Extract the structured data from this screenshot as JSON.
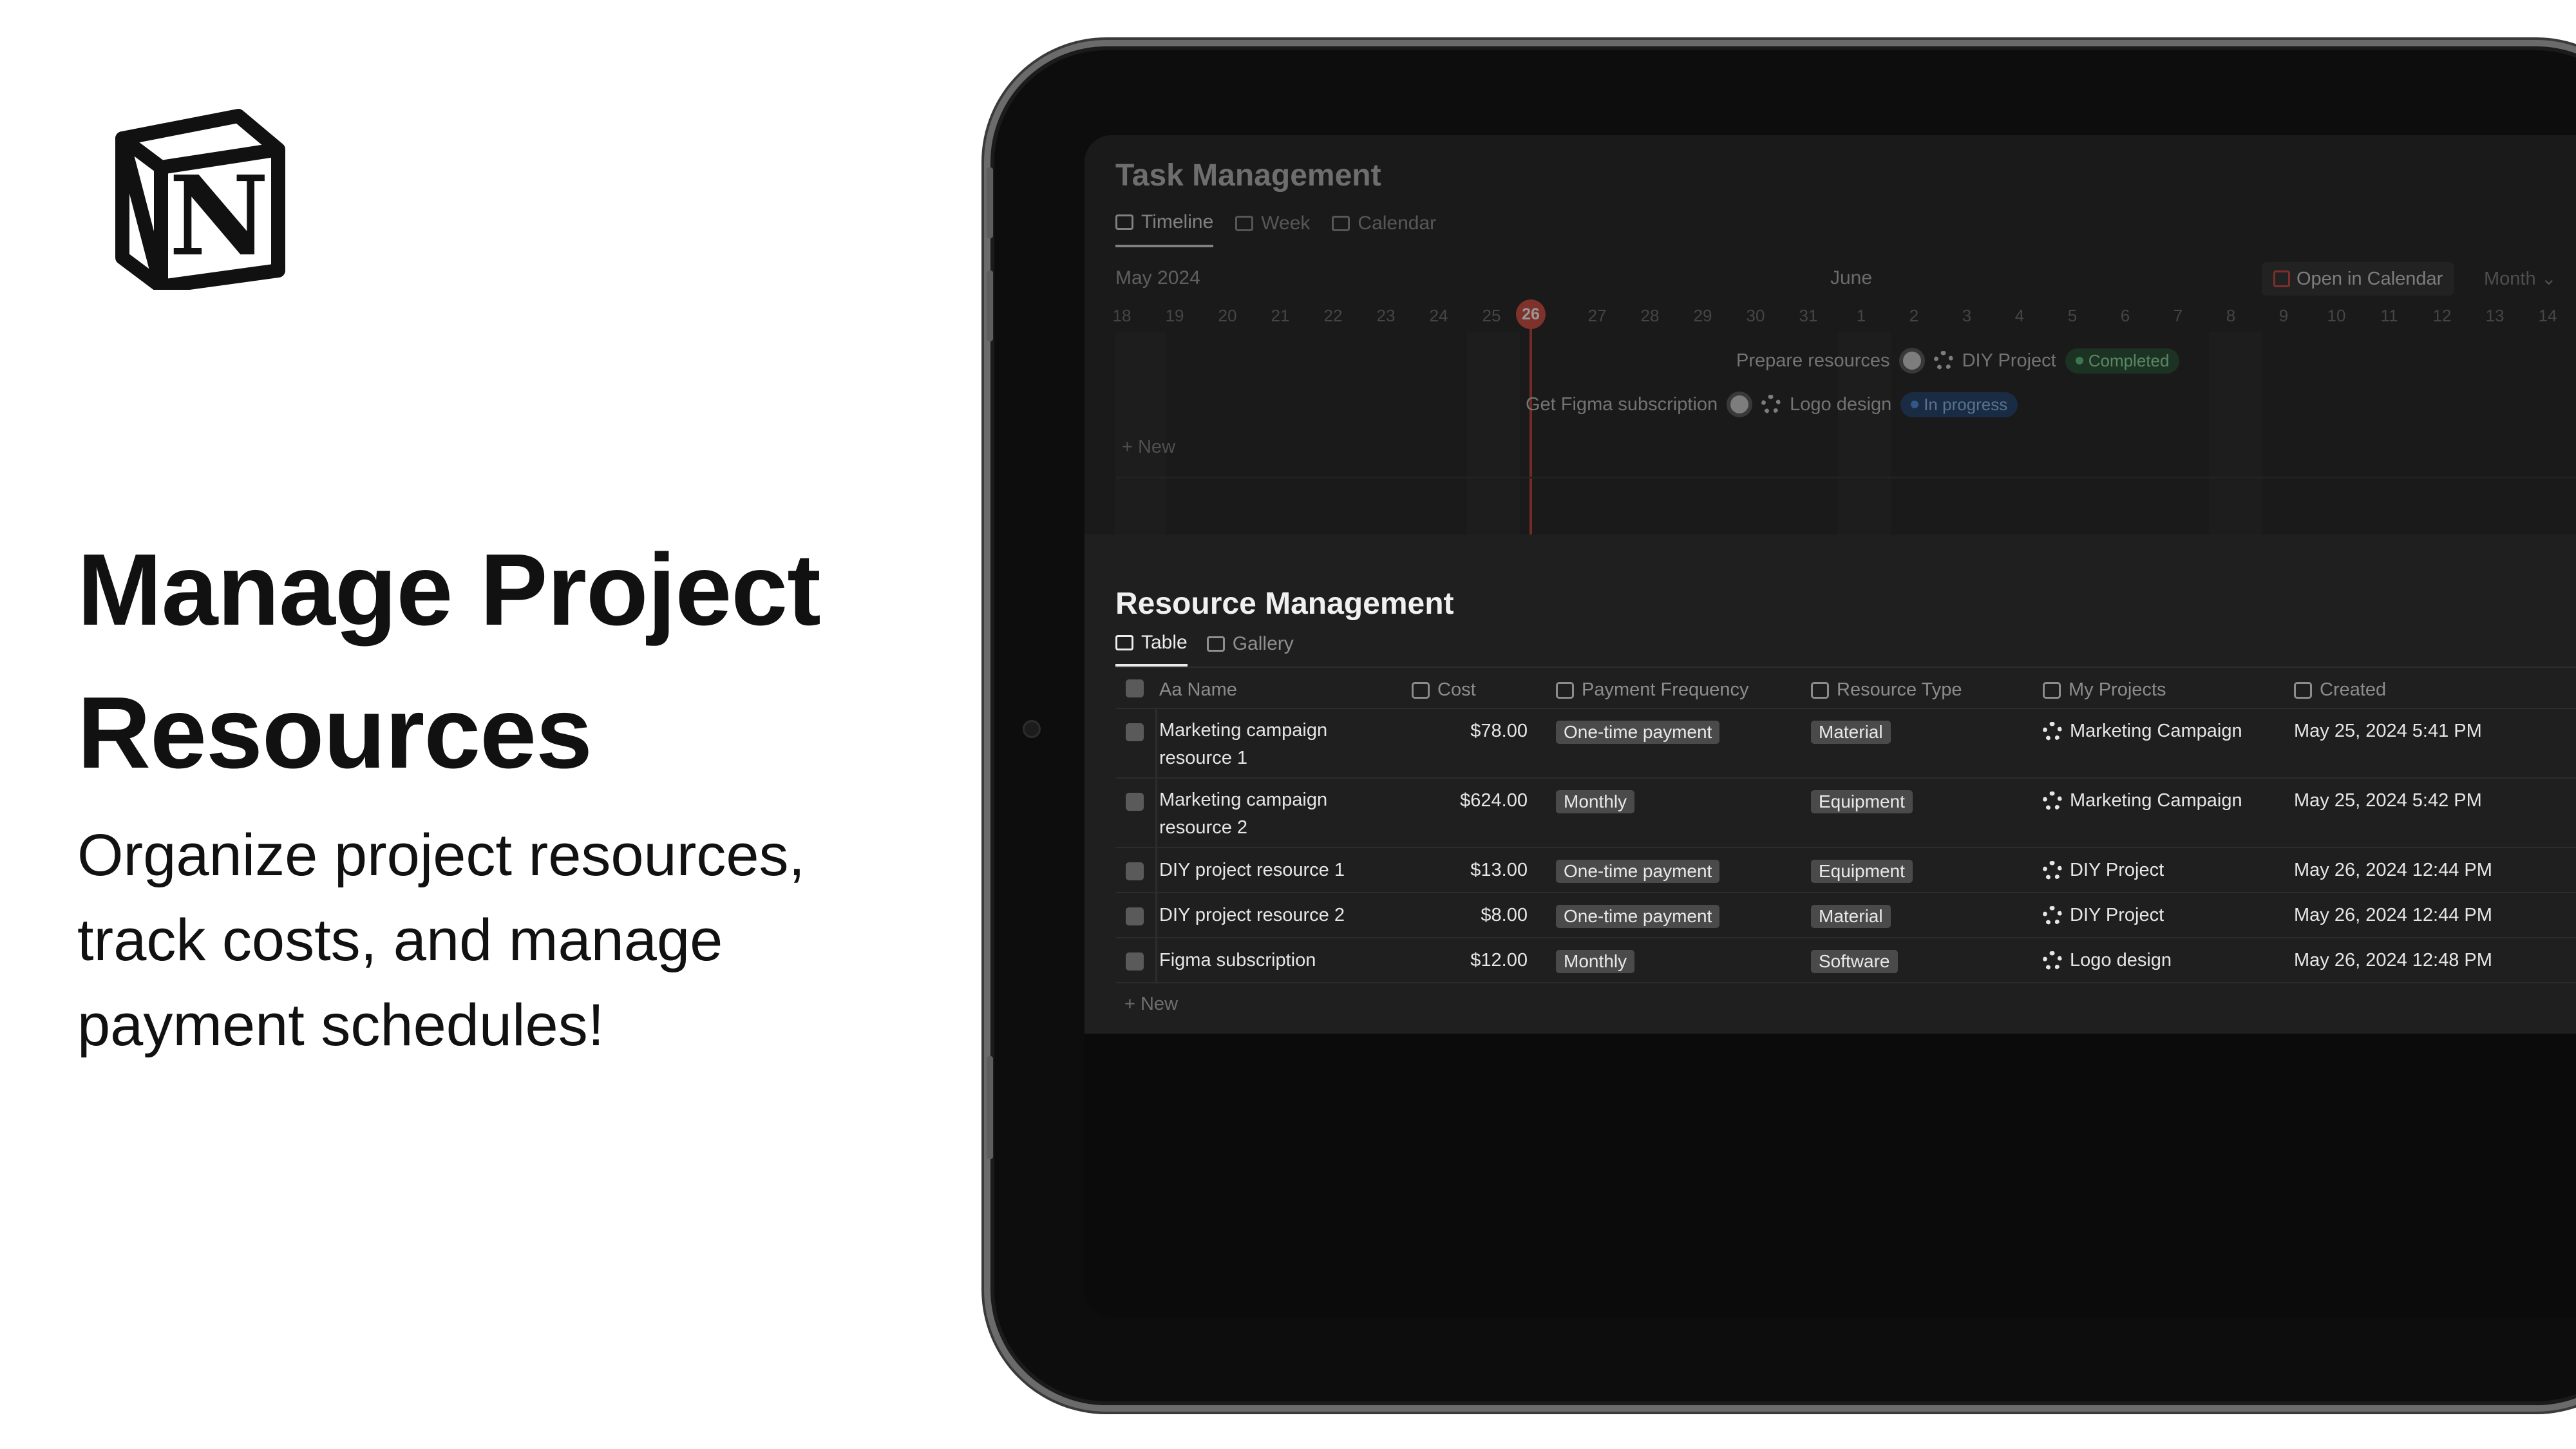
{
  "hero": {
    "headline_line1": "Manage Project",
    "headline_line2": "Resources",
    "subhead_line1": "Organize project resources,",
    "subhead_line2": "track costs, and manage",
    "subhead_line3": "payment schedules!"
  },
  "task_management": {
    "title": "Task Management",
    "tabs": [
      "Timeline",
      "Week",
      "Calendar"
    ],
    "month_left": "May 2024",
    "month_center": "June",
    "open_calendar_label": "Open in Calendar",
    "view_select": "Month ⌄",
    "days": [
      "18",
      "19",
      "20",
      "21",
      "22",
      "23",
      "24",
      "25",
      "26",
      "27",
      "28",
      "29",
      "30",
      "31",
      "1",
      "2",
      "3",
      "4",
      "5",
      "6",
      "7",
      "8",
      "9",
      "10",
      "11",
      "12",
      "13",
      "14"
    ],
    "today": "26",
    "tasks": [
      {
        "name": "Prepare resources",
        "project": "DIY Project",
        "status": "Completed",
        "status_color": "green"
      },
      {
        "name": "Get Figma subscription",
        "project": "Logo design",
        "status": "In progress",
        "status_color": "blue"
      }
    ],
    "new_label": "+ New"
  },
  "resource_management": {
    "title": "Resource Management",
    "tabs": [
      "Table",
      "Gallery"
    ],
    "columns": [
      "Aa Name",
      "Cost",
      "Payment Frequency",
      "Resource Type",
      "My Projects",
      "Created"
    ],
    "rows": [
      {
        "name": "Marketing campaign resource 1",
        "cost": "$78.00",
        "frequency": "One-time payment",
        "type": "Material",
        "project": "Marketing Campaign",
        "created": "May 25, 2024 5:41 PM"
      },
      {
        "name": "Marketing campaign resource 2",
        "cost": "$624.00",
        "frequency": "Monthly",
        "type": "Equipment",
        "project": "Marketing Campaign",
        "created": "May 25, 2024 5:42 PM"
      },
      {
        "name": "DIY project resource 1",
        "cost": "$13.00",
        "frequency": "One-time payment",
        "type": "Equipment",
        "project": "DIY Project",
        "created": "May 26, 2024 12:44 PM"
      },
      {
        "name": "DIY project resource 2",
        "cost": "$8.00",
        "frequency": "One-time payment",
        "type": "Material",
        "project": "DIY Project",
        "created": "May 26, 2024 12:44 PM"
      },
      {
        "name": "Figma subscription",
        "cost": "$12.00",
        "frequency": "Monthly",
        "type": "Software",
        "project": "Logo design",
        "created": "May 26, 2024 12:48 PM"
      }
    ],
    "new_label": "+ New"
  },
  "colors": {
    "today": "#d4453b",
    "completed": "#5cc27a",
    "in_progress": "#4a8de0"
  }
}
